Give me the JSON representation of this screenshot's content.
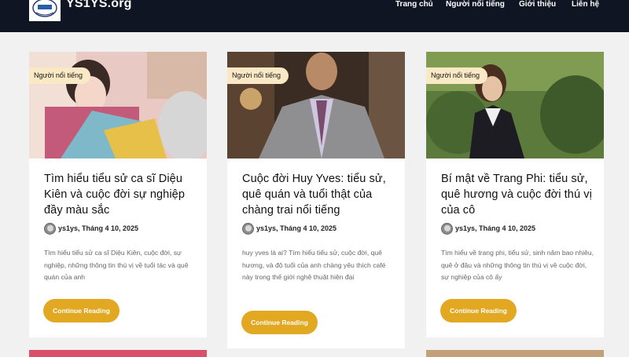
{
  "header": {
    "site_name": "YS1YS.org",
    "nav": [
      "Trang chủ",
      "Người nổi tiếng",
      "Giới thiệu",
      "Liên hệ"
    ]
  },
  "colors": {
    "header_bg": "#0f1522",
    "accent": "#e3a821",
    "badge_bg": "#fbe9c6"
  },
  "cards": [
    {
      "category": "Người nổi tiếng",
      "title": "Tìm hiểu tiểu sử ca sĩ Diệu Kiên và cuộc đời sự nghiệp đầy màu sắc",
      "meta": "ys1ys, Tháng 4 10, 2025",
      "excerpt": "Tìm hiểu tiểu sử ca sĩ Diệu Kiên, cuộc đời, sự nghiệp, những thông tin thú vị về tuổi tác và quê quán của anh",
      "button": "Continue Reading"
    },
    {
      "category": "Người nổi tiếng",
      "title": "Cuộc đời Huy Yves: tiểu sử, quê quán và tuổi thật của chàng trai nổi tiếng",
      "meta": "ys1ys, Tháng 4 10, 2025",
      "excerpt": "huy yves là ai? Tìm hiểu tiểu sử, cuộc đời, quê hương, và độ tuổi của anh chàng yêu thích café này trong thế giới nghệ thuật hiện đại",
      "button": "Continue Reading"
    },
    {
      "category": "Người nổi tiếng",
      "title": "Bí mật về Trang Phi: tiểu sử, quê hương và cuộc đời thú vị của cô",
      "meta": "ys1ys, Tháng 4 10, 2025",
      "excerpt": "Tìm hiểu về trang phi, tiểu sử, sinh năm bao nhiêu, quê ở đâu và những thông tin thú vị về cuộc đời, sự nghiệp của cô ấy",
      "button": "Continue Reading"
    }
  ]
}
